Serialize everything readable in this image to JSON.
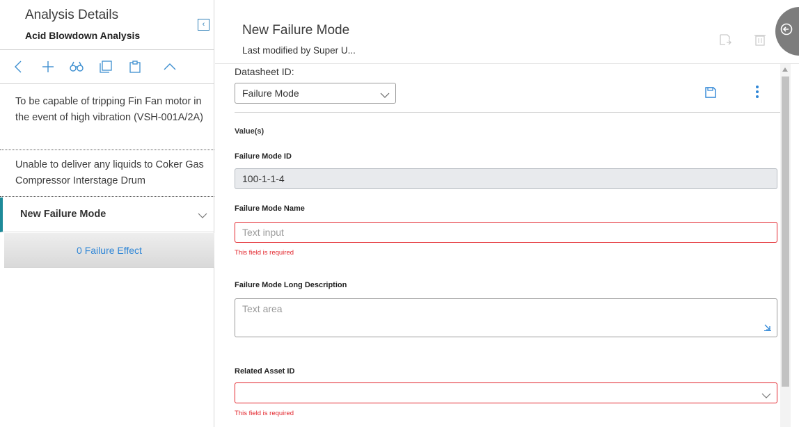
{
  "left_panel": {
    "title": "Analysis Details",
    "subtitle": "Acid Blowdown Analysis",
    "collapse_icon": "collapse-left-icon",
    "toolbar": [
      {
        "name": "back-icon"
      },
      {
        "name": "add-icon"
      },
      {
        "name": "binoculars-icon"
      },
      {
        "name": "copy-icon"
      },
      {
        "name": "paste-icon"
      },
      {
        "name": "chevron-up-icon"
      }
    ],
    "items": [
      {
        "label": "To be capable of tripping Fin Fan motor in the event of high vibration (VSH-001A/2A)"
      },
      {
        "label": "Unable to deliver any liquids to Coker Gas Compressor Interstage Drum"
      },
      {
        "label": "New Failure Mode",
        "selected": true
      }
    ],
    "effect_link": "0 Failure Effect"
  },
  "record": {
    "title": "New Failure Mode",
    "last_modified": "Last modified by Super U..."
  },
  "datasheet": {
    "label": "Datasheet ID:",
    "selected": "Failure Mode"
  },
  "form": {
    "values_label": "Value(s)",
    "failure_mode_id": {
      "label": "Failure Mode ID",
      "value": "100-1-1-4"
    },
    "failure_mode_name": {
      "label": "Failure Mode Name",
      "placeholder": "Text input",
      "error": "This field is required"
    },
    "long_description": {
      "label": "Failure Mode Long Description",
      "placeholder": "Text area"
    },
    "related_asset": {
      "label": "Related Asset ID",
      "value": "",
      "error": "This field is required"
    }
  },
  "colors": {
    "accent": "#2f86d6",
    "error": "#e2242b",
    "selected_marker": "#1d8a99"
  }
}
